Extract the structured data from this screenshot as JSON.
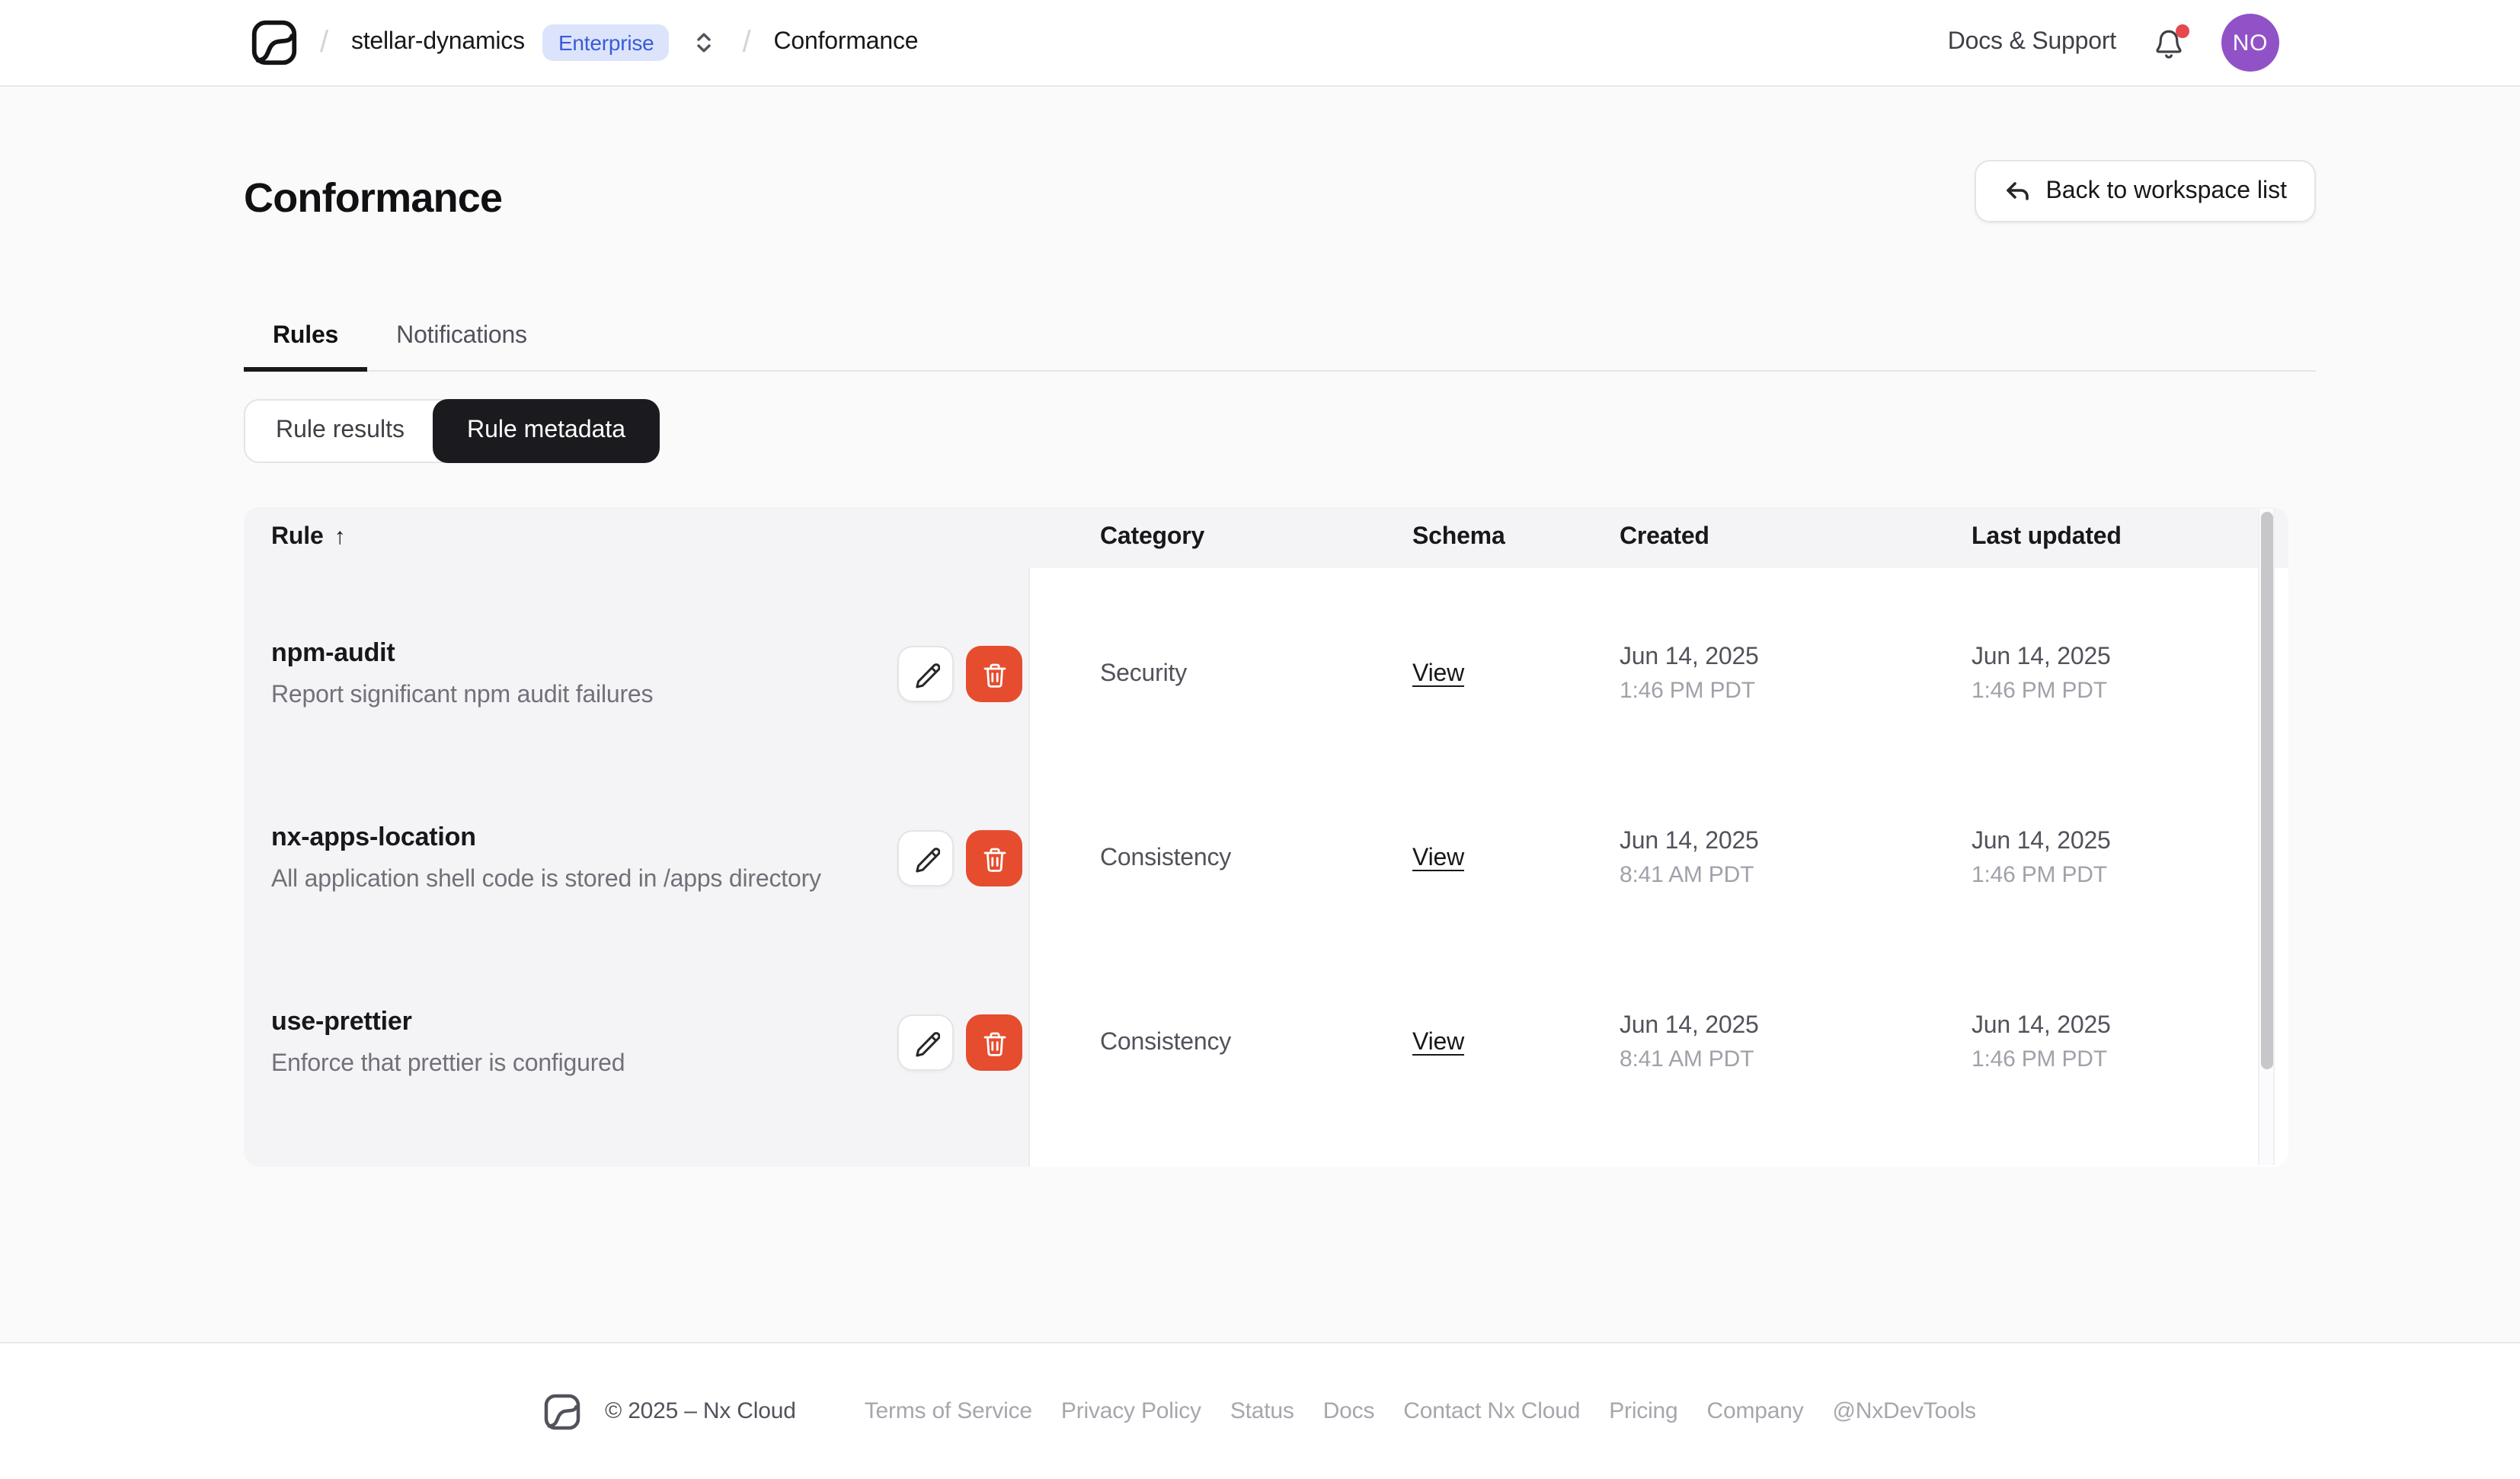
{
  "navbar": {
    "separator": "/",
    "workspace": "stellar-dynamics",
    "plan_badge": "Enterprise",
    "page": "Conformance",
    "docs_support": "Docs & Support",
    "avatar_initials": "NO"
  },
  "page": {
    "title": "Conformance",
    "back_button": "Back to workspace list"
  },
  "tabs": [
    {
      "label": "Rules",
      "active": true
    },
    {
      "label": "Notifications",
      "active": false
    }
  ],
  "segmented": [
    {
      "label": "Rule results",
      "active": false
    },
    {
      "label": "Rule metadata",
      "active": true
    }
  ],
  "table": {
    "columns": [
      "Rule",
      "Category",
      "Schema",
      "Created",
      "Last updated"
    ],
    "sort_column": "Rule",
    "sort_arrow": "↑",
    "schema_link_label": "View",
    "rows": [
      {
        "name": "npm-audit",
        "description": "Report significant npm audit failures",
        "category": "Security",
        "created_date": "Jun 14, 2025",
        "created_time": "1:46 PM PDT",
        "updated_date": "Jun 14, 2025",
        "updated_time": "1:46 PM PDT"
      },
      {
        "name": "nx-apps-location",
        "description": "All application shell code is stored in /apps directory",
        "category": "Consistency",
        "created_date": "Jun 14, 2025",
        "created_time": "8:41 AM PDT",
        "updated_date": "Jun 14, 2025",
        "updated_time": "1:46 PM PDT"
      },
      {
        "name": "use-prettier",
        "description": "Enforce that prettier is configured",
        "category": "Consistency",
        "created_date": "Jun 14, 2025",
        "created_time": "8:41 AM PDT",
        "updated_date": "Jun 14, 2025",
        "updated_time": "1:46 PM PDT"
      }
    ]
  },
  "footer": {
    "copyright": "© 2025 – Nx Cloud",
    "links": [
      "Terms of Service",
      "Privacy Policy",
      "Status",
      "Docs",
      "Contact Nx Cloud",
      "Pricing",
      "Company",
      "@NxDevTools"
    ]
  },
  "colors": {
    "accent": "#e54d2e",
    "badge-bg": "#dce4fc",
    "badge-text": "#3a5bd9",
    "avatar-bg": "#9152c7",
    "dot": "#e5484d"
  }
}
